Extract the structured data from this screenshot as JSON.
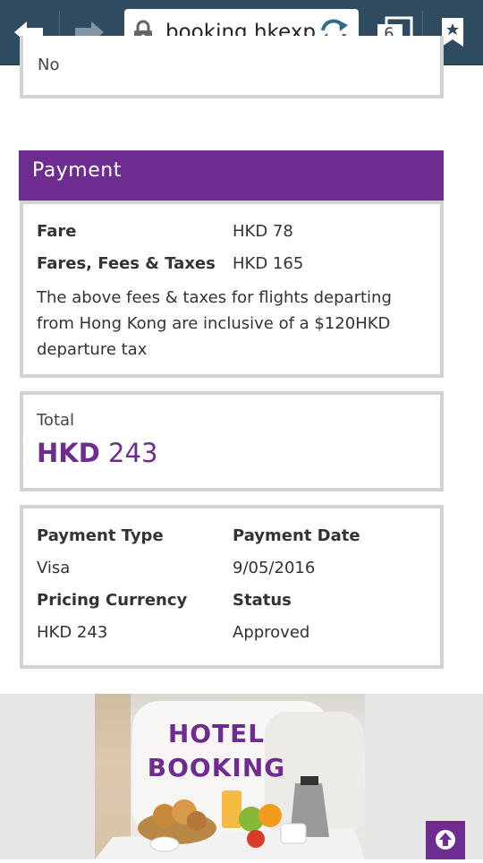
{
  "browser": {
    "url": "booking.hkexpr",
    "tab_count": "6"
  },
  "previous_section": {
    "value": "No"
  },
  "payment": {
    "header": "Payment",
    "fare_label": "Fare",
    "fare_value": "HKD 78",
    "fees_label": "Fares, Fees & Taxes",
    "fees_value": "HKD 165",
    "note": "The above fees & taxes for flights departing from Hong Kong are inclusive of a $120HKD departure tax"
  },
  "total": {
    "label": "Total",
    "currency": "HKD",
    "amount": "243"
  },
  "details": {
    "payment_type_label": "Payment Type",
    "payment_type_value": "Visa",
    "payment_date_label": "Payment Date",
    "payment_date_value": "9/05/2016",
    "pricing_currency_label": "Pricing Currency",
    "pricing_currency_value": "HKD 243",
    "status_label": "Status",
    "status_value": "Approved"
  },
  "banner": {
    "line1": "HOTEL",
    "line2": "BOOKING"
  },
  "colors": {
    "brand": "#6e2c91",
    "toolbar": "#2f4b5f",
    "border": "#d2d2d2"
  },
  "icons": [
    "back-arrow-icon",
    "forward-arrow-icon",
    "lock-icon",
    "reload-icon",
    "tabs-icon",
    "bookmark-star-icon",
    "arrow-up-circle-icon"
  ]
}
